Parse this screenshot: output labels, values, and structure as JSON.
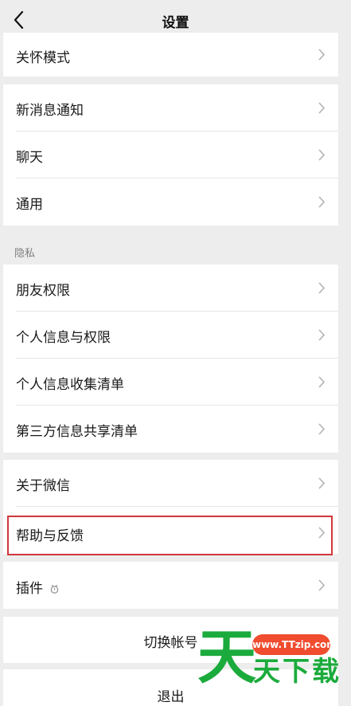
{
  "nav": {
    "title": "设置"
  },
  "group1": [
    {
      "label": "关怀模式"
    }
  ],
  "group2": [
    {
      "label": "新消息通知"
    },
    {
      "label": "聊天"
    },
    {
      "label": "通用"
    }
  ],
  "privacy": {
    "section_label": "隐私",
    "items": [
      {
        "label": "朋友权限"
      },
      {
        "label": "个人信息与权限"
      },
      {
        "label": "个人信息收集清单"
      },
      {
        "label": "第三方信息共享清单"
      }
    ]
  },
  "group4": [
    {
      "label": "关于微信"
    },
    {
      "label": "帮助与反馈"
    }
  ],
  "group5": [
    {
      "label": "插件"
    }
  ],
  "account": {
    "switch_label": "切换帐号",
    "logout_label": "退出"
  },
  "watermark": {
    "url": "www.TTzip.com",
    "big_char": "天",
    "text": "天下载",
    "color": "#1bab3c",
    "bubble_color": "#f04c2f"
  },
  "highlight_color": "#d0373b"
}
